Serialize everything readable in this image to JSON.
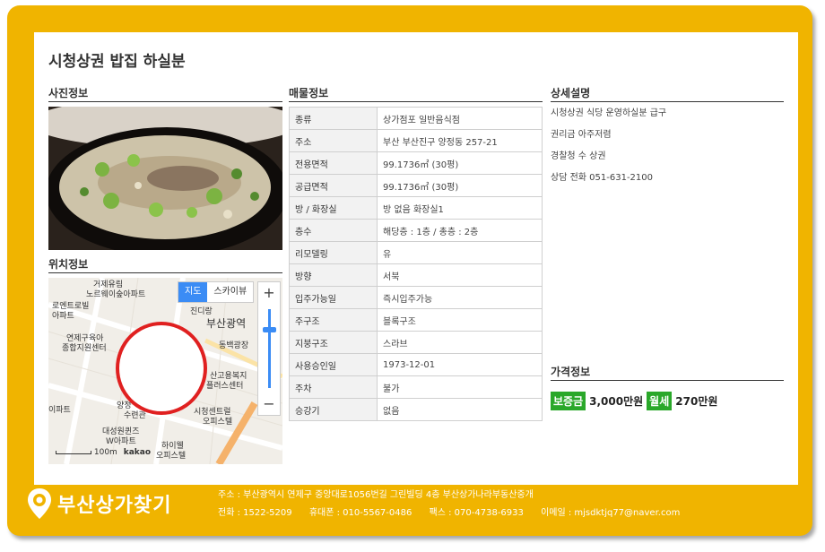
{
  "page": {
    "title": "시청상권 밥집 하실분"
  },
  "sections": {
    "photo": "사진정보",
    "location": "위치정보",
    "property": "매물정보",
    "detail": "상세설명",
    "price": "가격정보"
  },
  "map": {
    "toggle": [
      "지도",
      "스카이뷰"
    ],
    "zoom_in": "+",
    "zoom_out": "−",
    "labels": [
      "거제유림",
      "노르웨이숲아파트",
      "부산광역",
      "진디랑",
      "연제구육아",
      "종합지원센터",
      "동백광장",
      "산고용복지",
      "플러스센터",
      "양정",
      "수련관",
      "대성원퀸즈",
      "W아파트",
      "시청센트럴",
      "오피스텔",
      "하이웰",
      "오피스텔",
      "이파트",
      "아파트",
      "로엔트로빌"
    ],
    "scale_label": "100m",
    "brand": "kakao"
  },
  "property_table": [
    {
      "key": "종류",
      "value": "상가점포 일반음식점"
    },
    {
      "key": "주소",
      "value": "부산 부산진구 양정동 257-21"
    },
    {
      "key": "전용면적",
      "value": "99.1736㎡ (30평)"
    },
    {
      "key": "공급면적",
      "value": "99.1736㎡ (30평)"
    },
    {
      "key": "방 / 화장실",
      "value": "방 없음  화장실1"
    },
    {
      "key": "층수",
      "value": "해당층 : 1층 / 총층 : 2층"
    },
    {
      "key": "리모델링",
      "value": "유"
    },
    {
      "key": "방향",
      "value": "서북"
    },
    {
      "key": "입주가능일",
      "value": "즉시입주가능"
    },
    {
      "key": "주구조",
      "value": "블록구조"
    },
    {
      "key": "지붕구조",
      "value": "스라브"
    },
    {
      "key": "사용승인일",
      "value": "1973-12-01"
    },
    {
      "key": "주차",
      "value": "불가"
    },
    {
      "key": "승강기",
      "value": "없음"
    }
  ],
  "detail_lines": [
    "시청상권 식당 운영하실분 급구",
    "권리금 아주저렴",
    "경찰청 수 상권",
    "상담 전화 051-631-2100"
  ],
  "price": {
    "deposit_label": "보증금",
    "deposit_value": "3,000만원",
    "rent_label": "월세",
    "rent_value": "270만원"
  },
  "footer": {
    "logo_text": "부산상가찾기",
    "address": "주소 : 부산광역시 연제구 중앙대로1056번길 그린빌딩 4층 부산상가나라부동산중개",
    "phone": "전화 : 1522-5209",
    "mobile": "휴대폰 : 010-5567-0486",
    "fax": "팩스 : 070-4738-6933",
    "email": "이메일 : mjsdktjq77@naver.com"
  },
  "colors": {
    "frame": "#f0b400",
    "badge": "#2aa82a",
    "map_marker": "#e02020",
    "toggle_active": "#3b8cf5"
  }
}
